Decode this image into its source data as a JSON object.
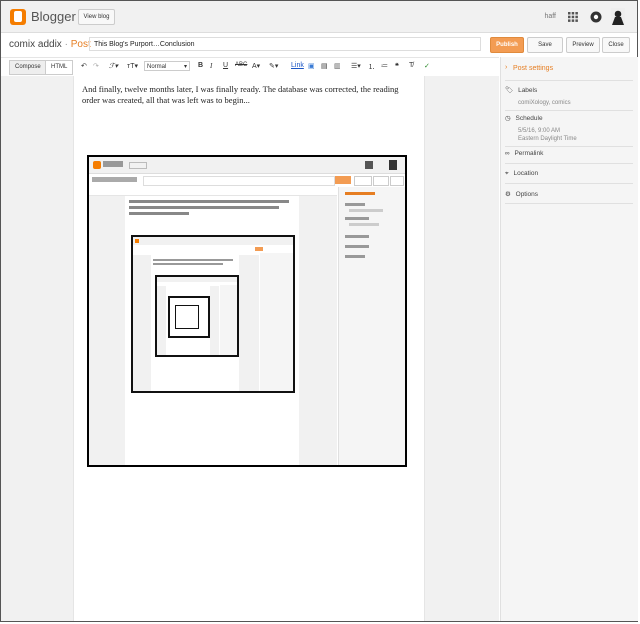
{
  "header": {
    "logo_text": "Blogger",
    "view_blog": "View blog",
    "user": "haff"
  },
  "post": {
    "blog_name": "comix addix",
    "separator": "·",
    "section": "Post",
    "title": "This Blog's Purport…Conclusion",
    "publish": "Publish",
    "save": "Save",
    "preview": "Preview",
    "close": "Close"
  },
  "toolbar": {
    "compose": "Compose",
    "html": "HTML",
    "format": "Normal",
    "link": "Link"
  },
  "editor": {
    "body": "And finally, twelve months later, I was finally ready. The database was corrected, the reading order was created, all that was left was to begin..."
  },
  "sidebar": {
    "heading": "Post settings",
    "labels": "Labels",
    "labels_value": "comiXology, comics",
    "schedule": "Schedule",
    "schedule_value1": "5/5/16, 9:00 AM",
    "schedule_value2": "Eastern Daylight Time",
    "permalink": "Permalink",
    "location": "Location",
    "options": "Options"
  },
  "colors": {
    "accent": "#e67e22",
    "publish": "#f39c53"
  }
}
